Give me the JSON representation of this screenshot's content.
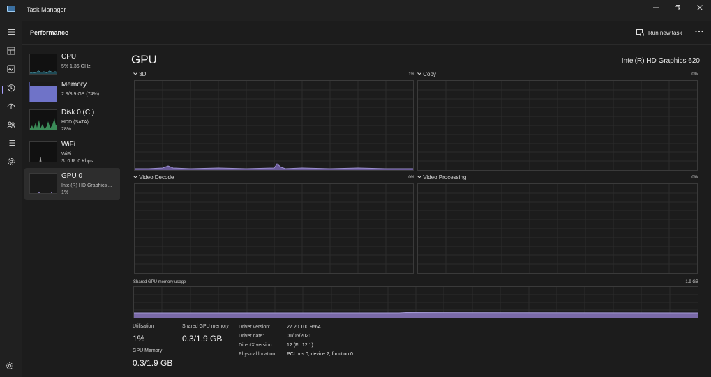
{
  "window": {
    "title": "Task Manager"
  },
  "header": {
    "page_title": "Performance",
    "run_new_task": "Run new task"
  },
  "rail": {
    "icons": [
      "menu-icon",
      "processes-icon",
      "performance-icon",
      "app-history-icon",
      "startup-apps-icon",
      "users-icon",
      "details-icon",
      "services-icon",
      "settings-icon"
    ]
  },
  "devices": [
    {
      "name": "CPU",
      "line1": "5%  1.36 GHz",
      "line2": ""
    },
    {
      "name": "Memory",
      "line1": "2.9/3.9 GB (74%)",
      "line2": ""
    },
    {
      "name": "Disk 0 (C:)",
      "line1": "HDD (SATA)",
      "line2": "28%"
    },
    {
      "name": "WiFi",
      "line1": "WiFi",
      "line2": "S: 0  R: 0 Kbps"
    },
    {
      "name": "GPU 0",
      "line1": "Intel(R) HD Graphics ...",
      "line2": "1%"
    }
  ],
  "gpu": {
    "title": "GPU",
    "model": "Intel(R) HD Graphics 620",
    "engines": [
      {
        "label": "3D",
        "percent": "1%"
      },
      {
        "label": "Copy",
        "percent": "0%"
      },
      {
        "label": "Video Decode",
        "percent": "0%"
      },
      {
        "label": "Video Processing",
        "percent": "0%"
      }
    ],
    "shared_memory_label": "Shared GPU memory usage",
    "shared_memory_max": "1.9 GB",
    "stats": {
      "utilisation_label": "Utilisation",
      "utilisation_value": "1%",
      "shared_label": "Shared GPU memory",
      "shared_value": "0.3/1.9 GB",
      "gpu_memory_label": "GPU Memory",
      "gpu_memory_value": "0.3/1.9 GB"
    },
    "info": [
      {
        "key": "Driver version:",
        "value": "27.20.100.9664"
      },
      {
        "key": "Driver date:",
        "value": "01/06/2021"
      },
      {
        "key": "DirectX version:",
        "value": "12 (FL 12.1)"
      },
      {
        "key": "Physical location:",
        "value": "PCI bus 0, device 2, function 0"
      }
    ]
  },
  "colors": {
    "accent": "#a9a2ff",
    "graph_line": "#9b8fd0",
    "graph_fill": "#6a5a9a",
    "memory_fill": "#6f73c8"
  }
}
